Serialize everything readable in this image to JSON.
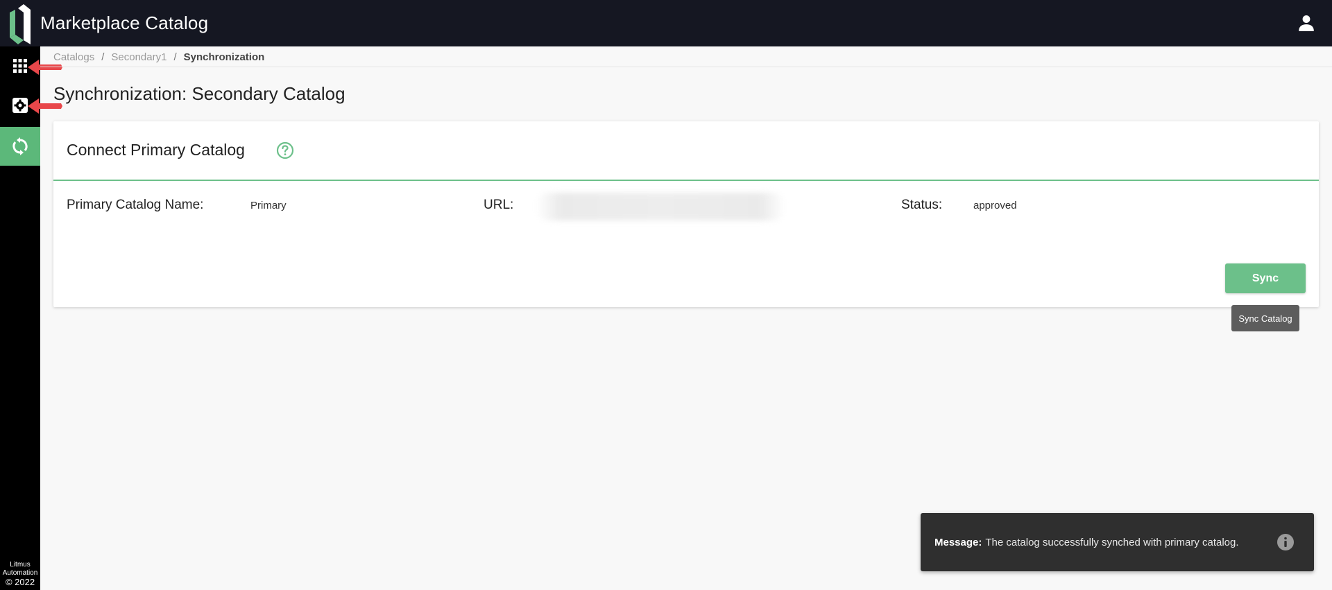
{
  "app": {
    "title": "Marketplace Catalog",
    "logo_icon": "litmus-logo-icon",
    "user_icon": "user-icon"
  },
  "sidebar": {
    "items": [
      {
        "name": "apps-grid",
        "icon": "grid-icon",
        "active": false
      },
      {
        "name": "settings",
        "icon": "gear-icon",
        "active": false
      },
      {
        "name": "synchronization",
        "icon": "sync-icon",
        "active": true
      }
    ],
    "footer": {
      "line1": "Litmus",
      "line2": "Automation",
      "line3": "© 2022"
    }
  },
  "breadcrumb": {
    "items": [
      "Catalogs",
      "Secondary1"
    ],
    "current": "Synchronization",
    "separator": "/"
  },
  "page": {
    "title": "Synchronization: Secondary Catalog"
  },
  "card": {
    "title": "Connect Primary Catalog",
    "help_icon": "question-circle-icon",
    "fields": {
      "name_label": "Primary Catalog Name:",
      "name_value": "Primary",
      "url_label": "URL:",
      "status_label": "Status:",
      "status_value": "approved"
    },
    "sync_button": "Sync",
    "tooltip": "Sync Catalog"
  },
  "toast": {
    "label": "Message:",
    "text": "The catalog successfully synched with primary catalog.",
    "icon": "info-icon"
  },
  "colors": {
    "accent": "#6cc08a",
    "topbar": "#151722",
    "sidebar": "#000000",
    "toast": "#2f2f2f"
  }
}
